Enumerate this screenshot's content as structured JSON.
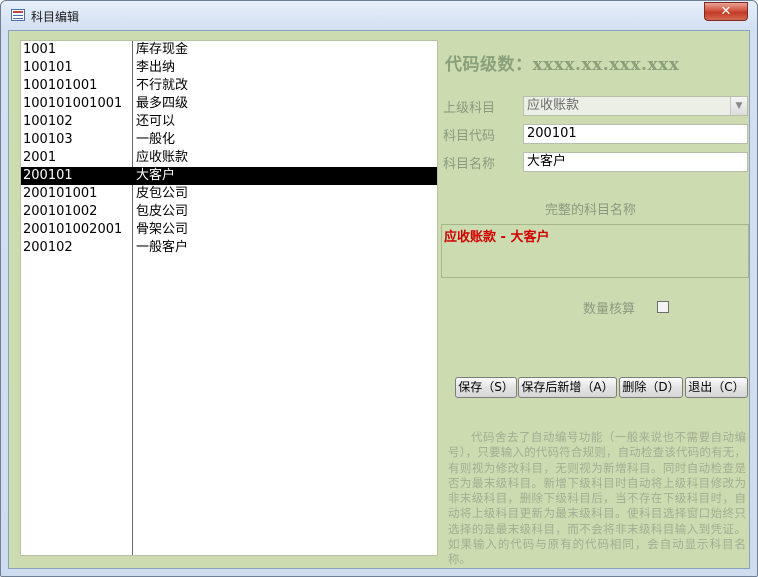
{
  "window": {
    "title": "科目编辑",
    "close_label": "✕"
  },
  "list": {
    "rows": [
      {
        "code": "1001",
        "name": "库存现金"
      },
      {
        "code": "100101",
        "name": "李出纳"
      },
      {
        "code": "100101001",
        "name": "不行就改"
      },
      {
        "code": "100101001001",
        "name": "最多四级"
      },
      {
        "code": "100102",
        "name": "还可以"
      },
      {
        "code": "100103",
        "name": "一般化"
      },
      {
        "code": "2001",
        "name": "应收账款"
      },
      {
        "code": "200101",
        "name": "大客户",
        "selected": true
      },
      {
        "code": "200101001",
        "name": "皮包公司"
      },
      {
        "code": "200101002",
        "name": "包皮公司"
      },
      {
        "code": "200101002001",
        "name": "骨架公司"
      },
      {
        "code": "200102",
        "name": "一般客户"
      }
    ]
  },
  "form": {
    "code_levels_heading": "代码级数：xxxx.xx.xxx.xxx",
    "parent_label": "上级科目",
    "parent_value": "应收账款",
    "code_label": "科目代码",
    "code_value": "200101",
    "name_label": "科目名称",
    "name_value": "大客户",
    "full_name_label": "完整的科目名称",
    "full_name_value": "应收账款 - 大客户",
    "quantity_label": "数量核算",
    "quantity_checked": false
  },
  "buttons": {
    "save": "保存（S）",
    "save_new": "保存后新增（A）",
    "delete": "删除（D）",
    "exit": "退出（C）"
  },
  "help_text": "代码舍去了自动编号功能（一般来说也不需要自动编号），只要输入的代码符合规则，自动检查该代码的有无，有则视为修改科目，无则视为新增科目。同时自动检查是否为最末级科目。新增下级科目时自动将上级科目修改为非末级科目，删除下级科目后，当不存在下级科目时，自动将上级科目更新为最末级科目。使科目选择窗口始终只选择的是最末级科目，而不会将非末级科目输入到凭证。如果输入的代码与原有的代码相同，会自动显示科目名称。",
  "colors": {
    "panel_bg": "#cddbb0",
    "full_name_text": "#d00000",
    "selected_row_bg": "#000000"
  }
}
